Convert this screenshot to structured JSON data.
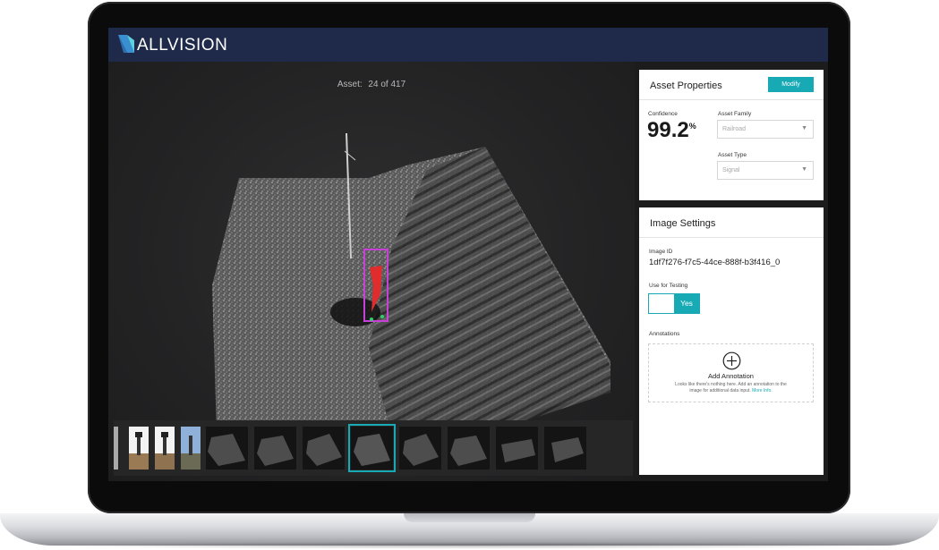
{
  "app": {
    "title": "ALLVISION"
  },
  "viewer": {
    "counter_label": "Asset:",
    "counter_value": "24 of 417",
    "thumbnails": [
      {
        "kind": "photo"
      },
      {
        "kind": "photo"
      },
      {
        "kind": "photo"
      },
      {
        "kind": "pointcloud"
      },
      {
        "kind": "pointcloud"
      },
      {
        "kind": "pointcloud"
      },
      {
        "kind": "pointcloud",
        "selected": true
      },
      {
        "kind": "pointcloud"
      },
      {
        "kind": "pointcloud"
      },
      {
        "kind": "pointcloud"
      },
      {
        "kind": "pointcloud"
      }
    ]
  },
  "asset_properties": {
    "title": "Asset Properties",
    "modify_label": "Modify",
    "confidence_label": "Confidence",
    "confidence_value": "99.2",
    "confidence_unit": "%",
    "family_label": "Asset Family",
    "family_value": "Railroad",
    "type_label": "Asset Type",
    "type_value": "Signal"
  },
  "image_settings": {
    "title": "Image Settings",
    "image_id_label": "Image ID",
    "image_id_value": "1df7f276-f7c5-44ce-888f-b3f416_0",
    "testing_label": "Use for Testing",
    "testing_value": "Yes",
    "annotations_label": "Annotations",
    "add_annotation_label": "Add Annotation",
    "annotation_desc_line1": "Looks like there's nothing here. Add an annotation to the",
    "annotation_desc_line2": "image for additional data input.",
    "more_info_label": "More Info."
  },
  "colors": {
    "accent": "#17a9b4",
    "header": "#1f2a4b"
  }
}
